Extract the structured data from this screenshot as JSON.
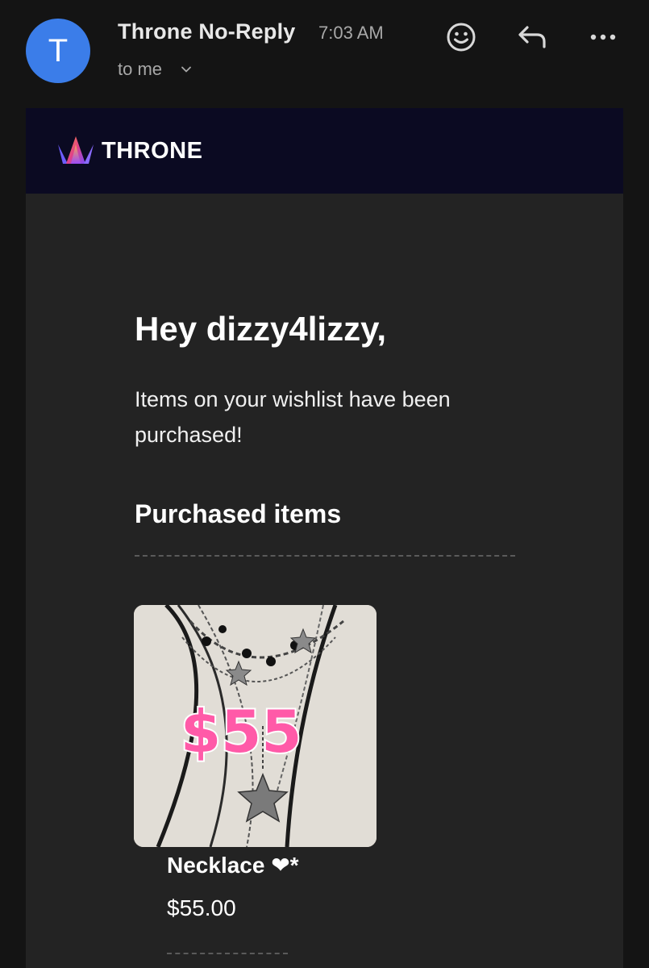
{
  "email": {
    "sender_initial": "T",
    "sender_name": "Throne No-Reply",
    "time": "7:03 AM",
    "recipient": "to me",
    "icons": [
      "emoji-icon",
      "reply-icon",
      "more-icon",
      "chevron-down-icon"
    ]
  },
  "brand": {
    "name": "THRONE",
    "logo_icon": "crown-logo-icon"
  },
  "body": {
    "greeting": "Hey dizzy4lizzy,",
    "message": "Items on your wishlist have been purchased!",
    "section_title": "Purchased items"
  },
  "items": [
    {
      "name": "Necklace ❤*",
      "price": "$55.00",
      "image_overlay": "$55"
    }
  ],
  "colors": {
    "avatar": "#3b7de9",
    "brandbar": "#0b0a22",
    "card": "#232323",
    "price_overlay": "#ff5aa8"
  }
}
